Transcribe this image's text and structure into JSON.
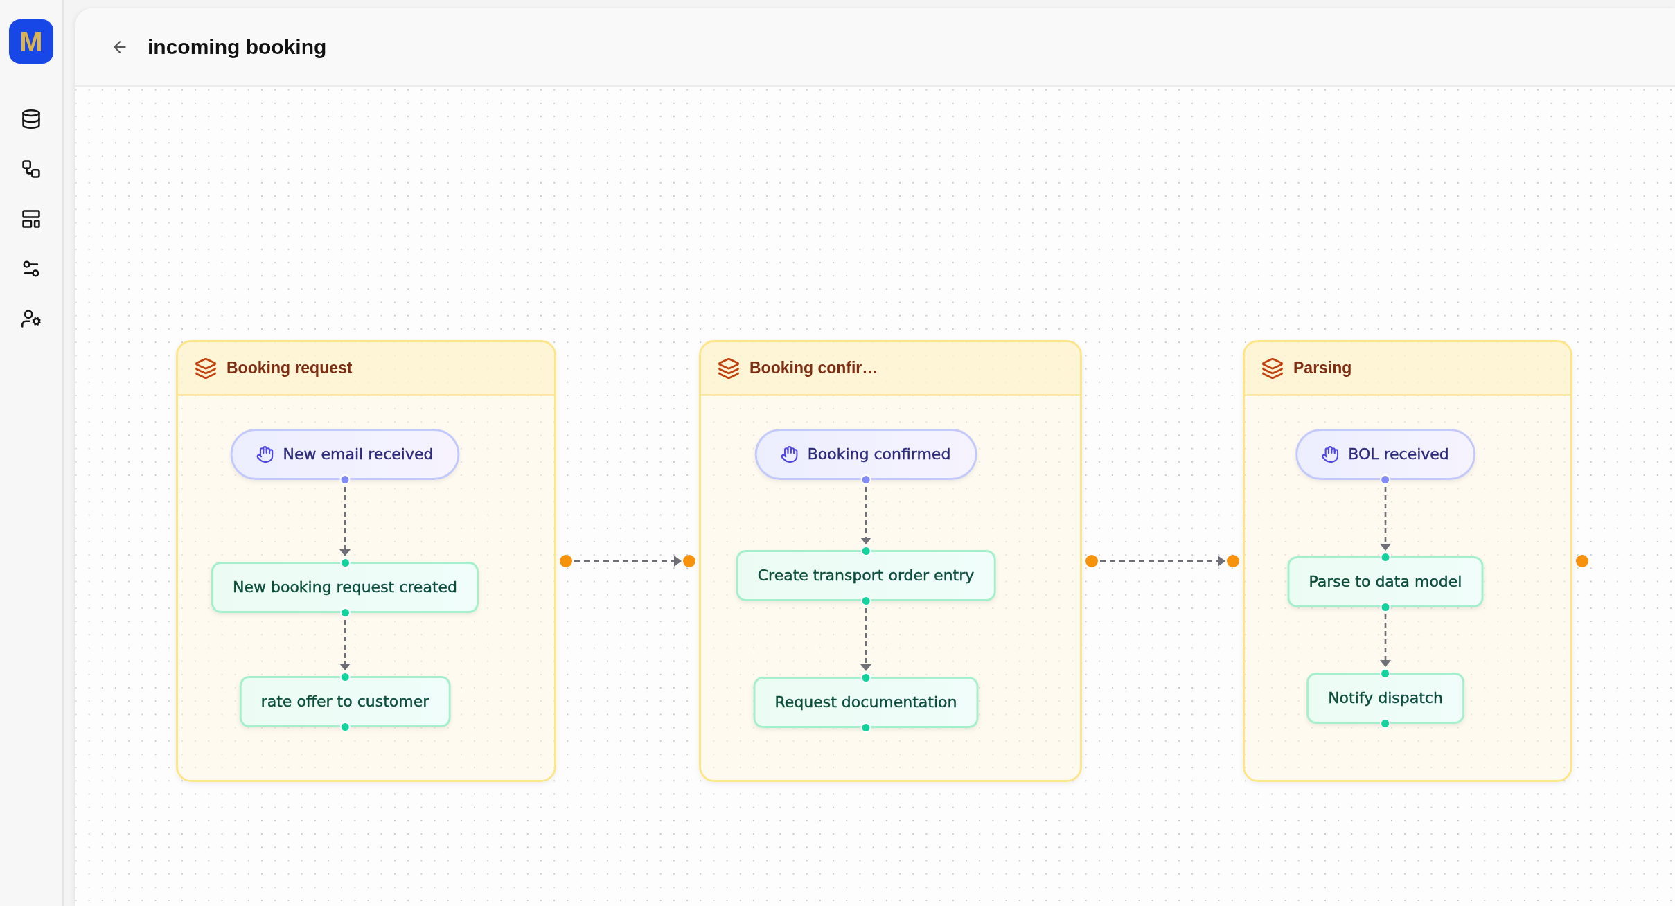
{
  "sidebar": {
    "logo": "M"
  },
  "header": {
    "title": "incoming booking"
  },
  "groups": [
    {
      "title": "Booking request",
      "input_handle": false,
      "output_handle": true,
      "nodes": [
        {
          "kind": "trigger",
          "label": "New email received"
        },
        {
          "kind": "action",
          "label": "New booking request created"
        },
        {
          "kind": "action",
          "label": "rate offer to customer"
        }
      ]
    },
    {
      "title": "Booking confir…",
      "input_handle": true,
      "output_handle": true,
      "nodes": [
        {
          "kind": "trigger",
          "label": "Booking confirmed"
        },
        {
          "kind": "action",
          "label": "Create transport order entry"
        },
        {
          "kind": "action",
          "label": "Request documentation"
        }
      ]
    },
    {
      "title": "Parsing",
      "input_handle": true,
      "output_handle": true,
      "nodes": [
        {
          "kind": "trigger",
          "label": "BOL received"
        },
        {
          "kind": "action",
          "label": "Parse to data model"
        },
        {
          "kind": "action",
          "label": "Notify dispatch"
        }
      ]
    }
  ]
}
